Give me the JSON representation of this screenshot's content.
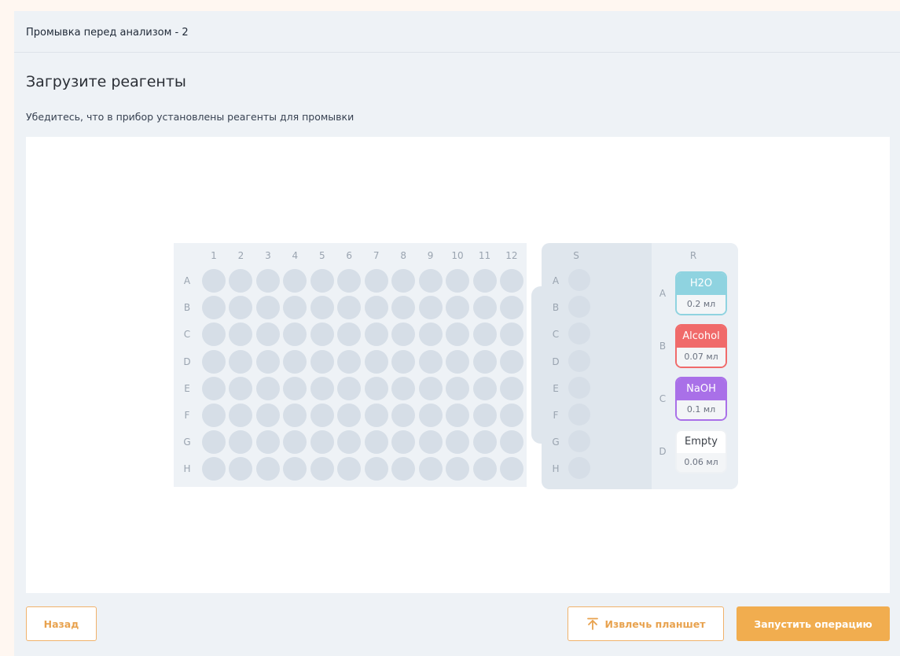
{
  "topbar": {
    "title": "Промывка перед анализом - 2"
  },
  "page": {
    "heading": "Загрузите реагенты",
    "subheading": "Убедитесь, что в прибор установлены реагенты для промывки"
  },
  "plate": {
    "columns": [
      "1",
      "2",
      "3",
      "4",
      "5",
      "6",
      "7",
      "8",
      "9",
      "10",
      "11",
      "12"
    ],
    "rows": [
      "A",
      "B",
      "C",
      "D",
      "E",
      "F",
      "G",
      "H"
    ]
  },
  "samples": {
    "header": "S",
    "rows": [
      "A",
      "B",
      "C",
      "D",
      "E",
      "F",
      "G",
      "H"
    ]
  },
  "reagents": {
    "header": "R",
    "items": [
      {
        "row": "A",
        "name": "H2O",
        "volume": "0.2 мл",
        "color": "#8fd3e0",
        "border": "#8fd3e0",
        "text_color": "#ffffff"
      },
      {
        "row": "B",
        "name": "Alcohol",
        "volume": "0.07 мл",
        "color": "#f06a6a",
        "border": "#f06a6a",
        "text_color": "#ffffff"
      },
      {
        "row": "C",
        "name": "NaOH",
        "volume": "0.1 мл",
        "color": "#a970e8",
        "border": "#a970e8",
        "text_color": "#ffffff"
      },
      {
        "row": "D",
        "name": "Empty",
        "volume": "0.06 мл",
        "color": "#ffffff",
        "border": "#eef1f4",
        "text_color": "#3a3f47"
      }
    ]
  },
  "buttons": {
    "back": "Назад",
    "eject": "Извлечь планшет",
    "eject_icon": "upload-arrow-icon",
    "run": "Запустить операцию"
  },
  "colors": {
    "accent": "#f1ad4f",
    "accent_outline": "#e8a24e",
    "well": "#d6dee7"
  }
}
